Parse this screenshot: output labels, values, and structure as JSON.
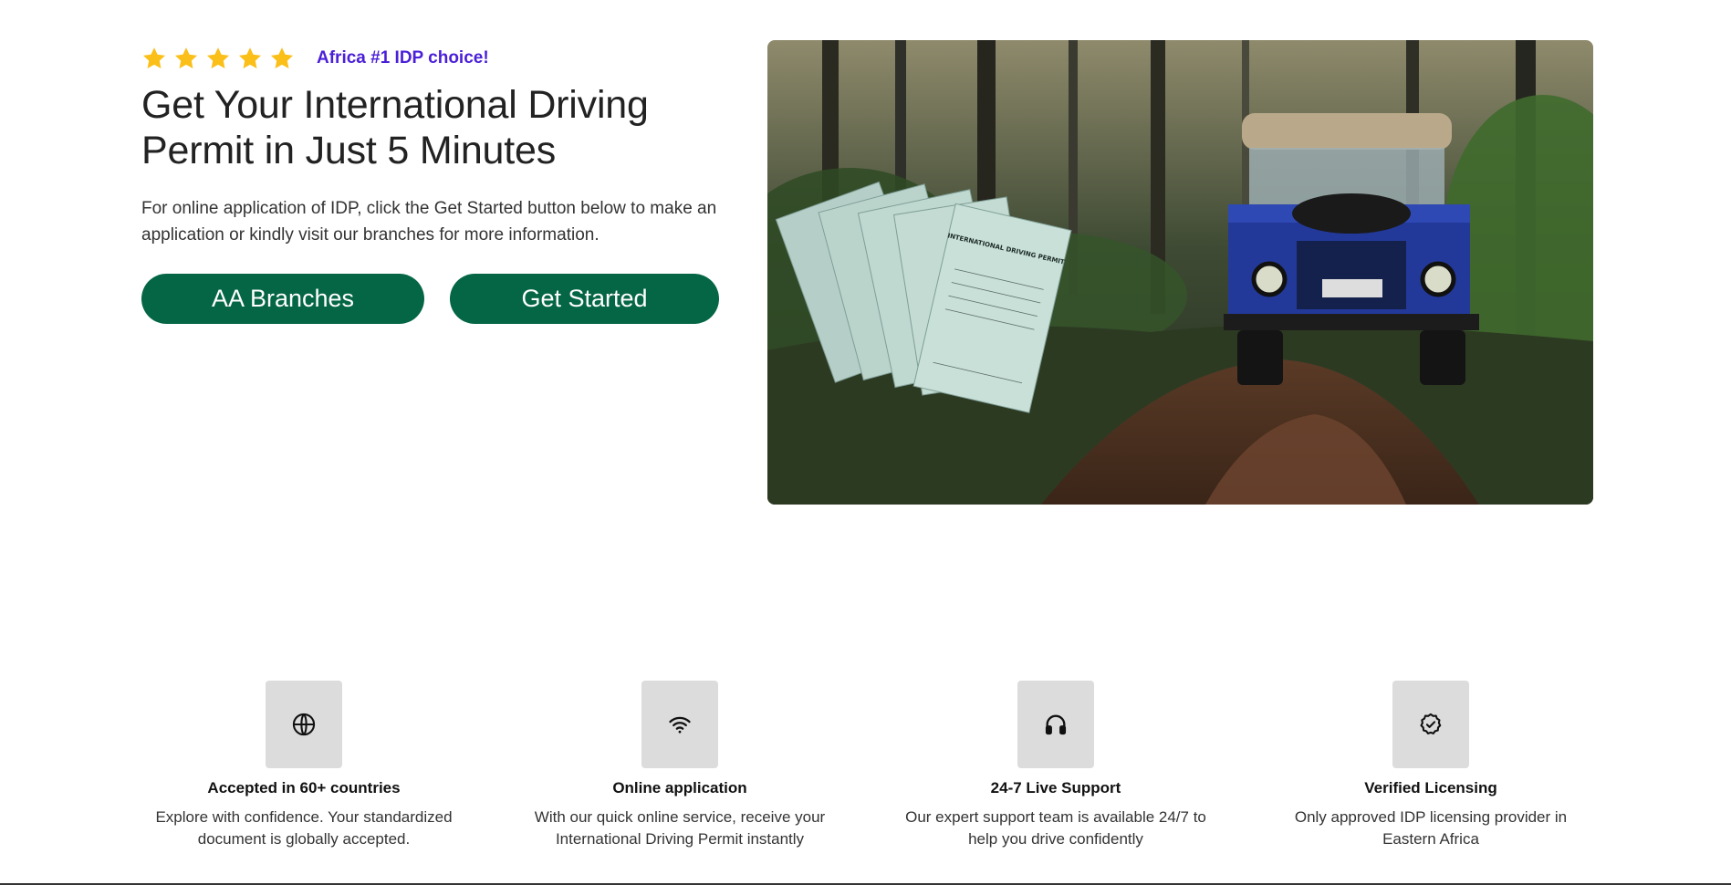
{
  "hero": {
    "rating": {
      "stars": 5,
      "tagline": "Africa #1 IDP choice!"
    },
    "title": "Get Your International Driving Permit in Just 5 Minutes",
    "description": "For online application of IDP, click the Get Started button below to make an application or kindly visit our branches for more information.",
    "buttons": {
      "branches_label": "AA Branches",
      "start_label": "Get Started"
    },
    "image": {
      "permit_heading": "INTERNATIONAL DRIVING PERMIT"
    }
  },
  "features": [
    {
      "icon": "globe-icon",
      "title": "Accepted in 60+ countries",
      "description": "Explore with confidence. Your standardized document is globally accepted."
    },
    {
      "icon": "wifi-icon",
      "title": "Online application",
      "description": "With our quick online service, receive your International Driving Permit instantly"
    },
    {
      "icon": "headphones-icon",
      "title": "24-7 Live Support",
      "description": "Our expert support team is available 24/7 to help you drive confidently"
    },
    {
      "icon": "verified-badge-icon",
      "title": "Verified Licensing",
      "description": "Only approved IDP licensing provider in Eastern Africa"
    }
  ],
  "colors": {
    "brand_green": "#046644",
    "tagline_purple": "#4a1fd8",
    "star_gold": "#fbbf1a",
    "icon_box": "#dcdcdc"
  }
}
